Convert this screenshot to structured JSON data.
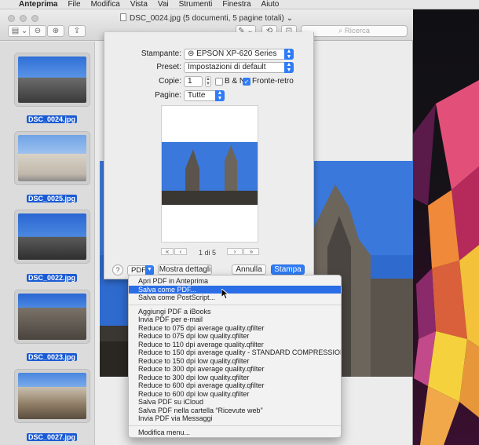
{
  "menubar": {
    "app": "Anteprima",
    "items": [
      "File",
      "Modifica",
      "Vista",
      "Vai",
      "Strumenti",
      "Finestra",
      "Aiuto"
    ]
  },
  "window": {
    "title": "DSC_0024.jpg (5 documenti, 5 pagine totali)",
    "search_placeholder": "Ricerca"
  },
  "sidebar": {
    "items": [
      {
        "label": "DSC_0024.jpg"
      },
      {
        "label": "DSC_0025.jpg"
      },
      {
        "label": "DSC_0022.jpg"
      },
      {
        "label": "DSC_0023.jpg"
      },
      {
        "label": "DSC_0027.jpg"
      }
    ]
  },
  "print": {
    "printer_label": "Stampante:",
    "printer_value": "EPSON XP-620 Series",
    "preset_label": "Preset:",
    "preset_value": "Impostazioni di default",
    "copies_label": "Copie:",
    "copies_value": "1",
    "bw_label": "B & N",
    "duplex_label": "Fronte-retro",
    "pages_label": "Pagine:",
    "pages_value": "Tutte",
    "page_indicator": "1 di 5",
    "help": "?",
    "pdf_button": "PDF",
    "details_button": "Mostra dettagli",
    "cancel_button": "Annulla",
    "print_button": "Stampa"
  },
  "pdf_menu": {
    "group1": [
      "Apri PDF in Anteprima",
      "Salva come PDF...",
      "Salva come PostScript..."
    ],
    "selected_index": 1,
    "group2": [
      "Aggiungi PDF a iBooks",
      "Invia PDF per e-mail",
      "Reduce to 075 dpi average quality.qfilter",
      "Reduce to 075 dpi low quality.qfilter",
      "Reduce to 110 dpi average quality.qfilter",
      "Reduce to 150 dpi average quality - STANDARD COMPRESSION.qfilter",
      "Reduce to 150 dpi low quality.qfilter",
      "Reduce to 300 dpi average quality.qfilter",
      "Reduce to 300 dpi low quality.qfilter",
      "Reduce to 600 dpi average quality.qfilter",
      "Reduce to 600 dpi low quality.qfilter",
      "Salva PDF su iCloud",
      "Salva PDF nella cartella “Ricevute web”",
      "Invia PDF via Messaggi"
    ],
    "group3": [
      "Modifica menu..."
    ]
  },
  "colors": {
    "accent": "#2f7cf6",
    "selection": "#1a5bd4",
    "sky": "#3c7fe0"
  }
}
